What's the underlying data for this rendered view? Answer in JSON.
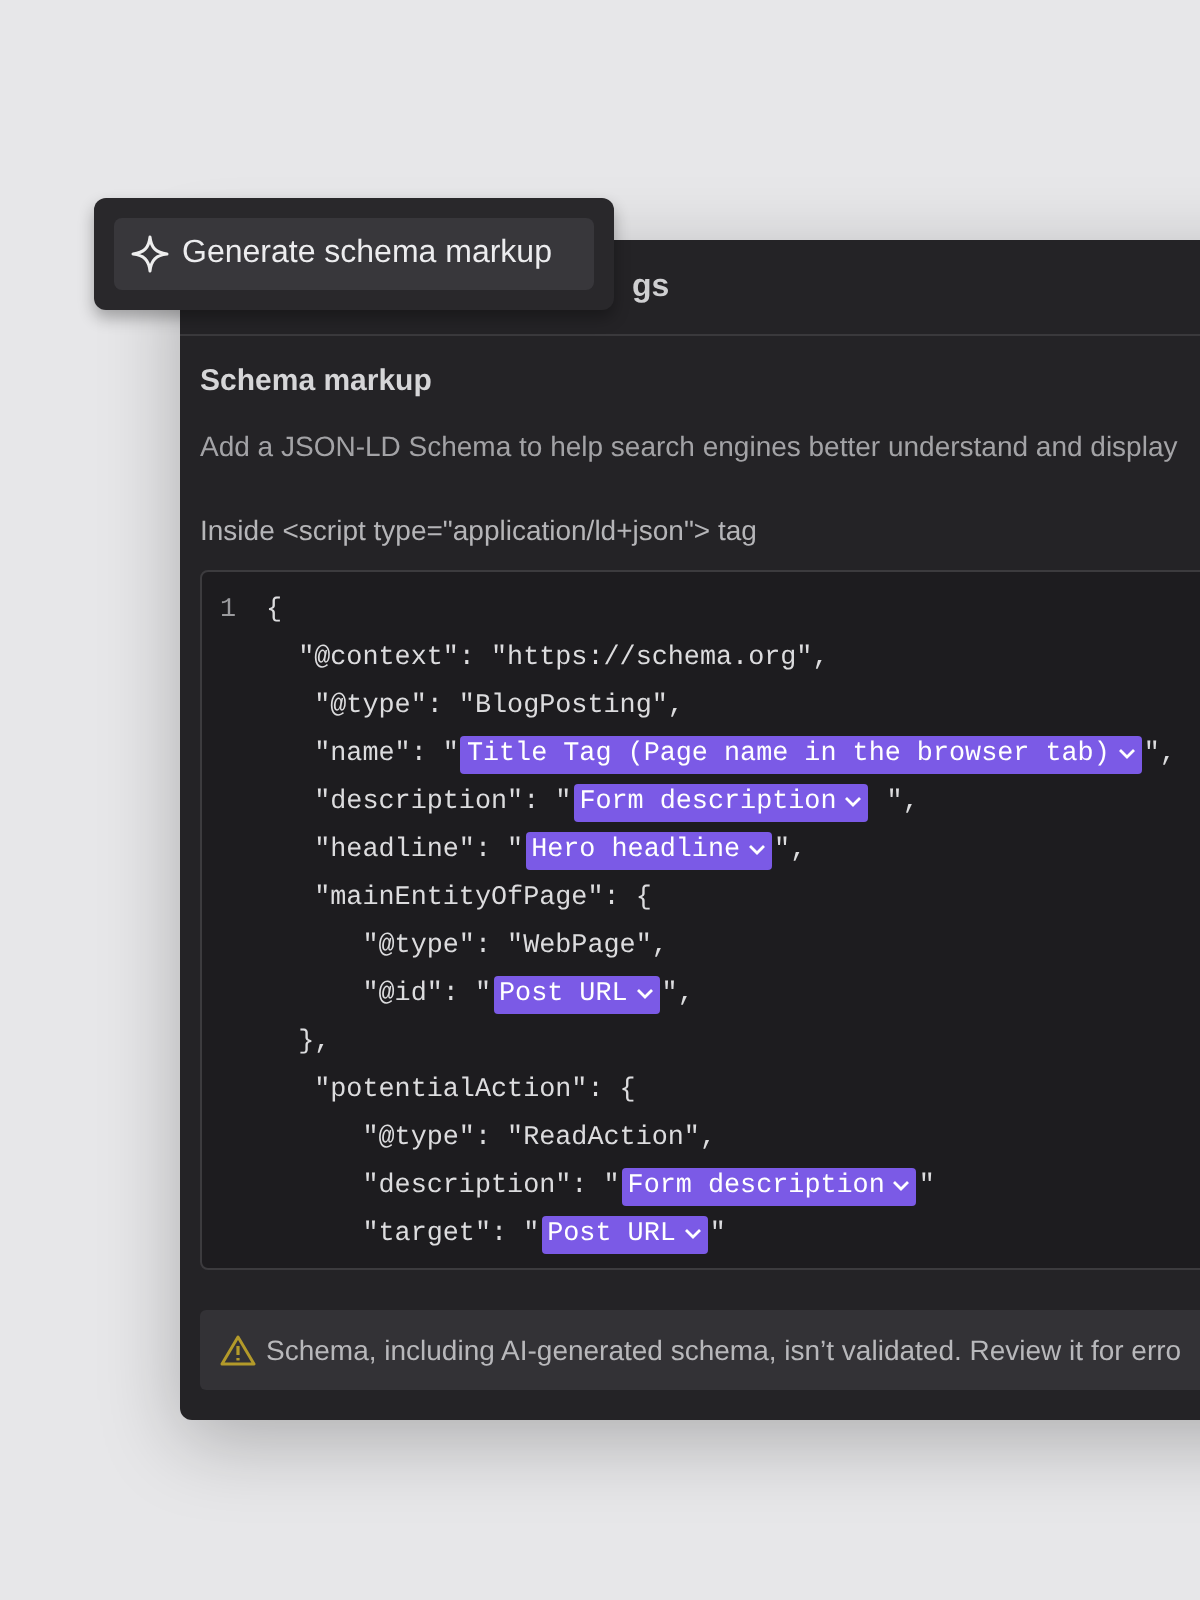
{
  "popup": {
    "button": "Generate schema markup"
  },
  "panel": {
    "title": "gs",
    "section_title": "Schema markup",
    "description": "Add a JSON-LD Schema to help search engines better understand and display",
    "code_label": "Inside <script type=\"application/ld+json\"> tag",
    "code_lines": [
      {
        "number": "1",
        "segments": [
          {
            "kind": "code",
            "text": "{"
          }
        ]
      },
      {
        "segments": [
          {
            "kind": "code",
            "text": "  \"@context\": \"https://schema.org\","
          }
        ]
      },
      {
        "segments": [
          {
            "kind": "code",
            "text": "   \"@type\": \"BlogPosting\","
          }
        ]
      },
      {
        "segments": [
          {
            "kind": "code",
            "text": "   \"name\": \""
          },
          {
            "kind": "token",
            "text": "Title Tag (Page name in the browser tab)"
          },
          {
            "kind": "code",
            "text": "\","
          }
        ]
      },
      {
        "segments": [
          {
            "kind": "code",
            "text": "   \"description\": \""
          },
          {
            "kind": "token",
            "text": "Form description"
          },
          {
            "kind": "code",
            "text": " \","
          }
        ]
      },
      {
        "segments": [
          {
            "kind": "code",
            "text": "   \"headline\": \""
          },
          {
            "kind": "token",
            "text": "Hero headline"
          },
          {
            "kind": "code",
            "text": "\","
          }
        ]
      },
      {
        "segments": [
          {
            "kind": "code",
            "text": "   \"mainEntityOfPage\": {"
          }
        ]
      },
      {
        "segments": [
          {
            "kind": "code",
            "text": "      \"@type\": \"WebPage\","
          }
        ]
      },
      {
        "segments": [
          {
            "kind": "code",
            "text": "      \"@id\": \""
          },
          {
            "kind": "token",
            "text": "Post URL"
          },
          {
            "kind": "code",
            "text": "\","
          }
        ]
      },
      {
        "segments": [
          {
            "kind": "code",
            "text": "  },"
          }
        ]
      },
      {
        "segments": [
          {
            "kind": "code",
            "text": "   \"potentialAction\": {"
          }
        ]
      },
      {
        "segments": [
          {
            "kind": "code",
            "text": "      \"@type\": \"ReadAction\","
          }
        ]
      },
      {
        "segments": [
          {
            "kind": "code",
            "text": "      \"description\": \""
          },
          {
            "kind": "token",
            "text": "Form description"
          },
          {
            "kind": "code",
            "text": "\""
          }
        ]
      },
      {
        "segments": [
          {
            "kind": "code",
            "text": "      \"target\": \""
          },
          {
            "kind": "token",
            "text": "Post URL"
          },
          {
            "kind": "code",
            "text": "\""
          }
        ]
      }
    ],
    "warning": "Schema, including AI-generated schema, isn’t validated. Review it for erro"
  }
}
